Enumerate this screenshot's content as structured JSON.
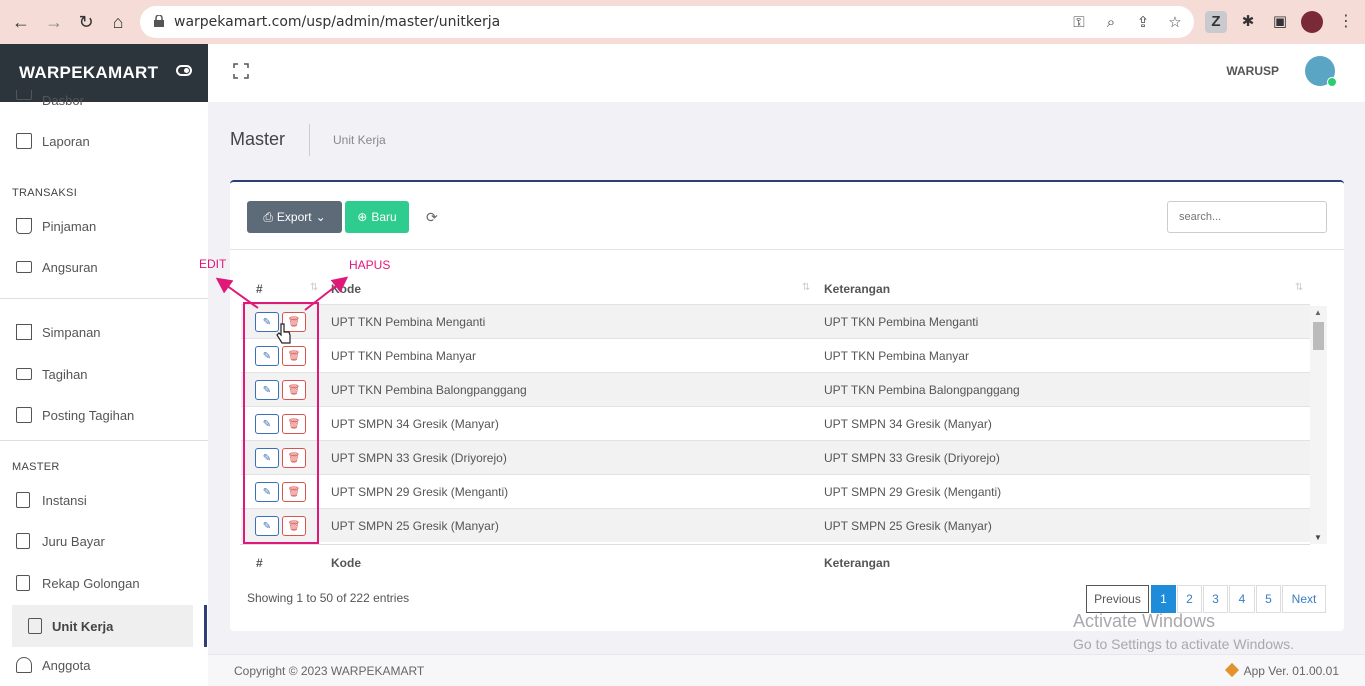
{
  "browser": {
    "url": "warpekamart.com/usp/admin/master/unitkerja"
  },
  "sidebar": {
    "brand": "WARPEKAMART",
    "top_items": [
      {
        "label": "Dasbor"
      },
      {
        "label": "Laporan"
      }
    ],
    "section_transaksi": "TRANSAKSI",
    "transaksi_items": [
      {
        "label": "Pinjaman"
      },
      {
        "label": "Angsuran"
      }
    ],
    "mid_items": [
      {
        "label": "Simpanan"
      },
      {
        "label": "Tagihan"
      },
      {
        "label": "Posting Tagihan"
      }
    ],
    "section_master": "MASTER",
    "master_items": [
      {
        "label": "Instansi"
      },
      {
        "label": "Juru Bayar"
      },
      {
        "label": "Rekap Golongan"
      },
      {
        "label": "Unit Kerja"
      },
      {
        "label": "Anggota"
      }
    ]
  },
  "header": {
    "user_name": "WARUSP"
  },
  "page": {
    "title": "Master",
    "breadcrumb": "Unit Kerja"
  },
  "toolbar": {
    "export_label": "Export",
    "new_label": "Baru",
    "search_placeholder": "search..."
  },
  "table": {
    "columns": [
      "#",
      "Kode",
      "Keterangan"
    ],
    "rows": [
      {
        "kode": "UPT TKN Pembina Menganti",
        "keterangan": "UPT TKN Pembina Menganti"
      },
      {
        "kode": "UPT TKN Pembina Manyar",
        "keterangan": "UPT TKN Pembina Manyar"
      },
      {
        "kode": "UPT TKN Pembina Balongpanggang",
        "keterangan": "UPT TKN Pembina Balongpanggang"
      },
      {
        "kode": "UPT SMPN 34 Gresik (Manyar)",
        "keterangan": "UPT SMPN 34 Gresik (Manyar)"
      },
      {
        "kode": "UPT SMPN 33 Gresik (Driyorejo)",
        "keterangan": "UPT SMPN 33 Gresik (Driyorejo)"
      },
      {
        "kode": "UPT SMPN 29 Gresik (Menganti)",
        "keterangan": "UPT SMPN 29 Gresik (Menganti)"
      },
      {
        "kode": "UPT SMPN 25 Gresik (Manyar)",
        "keterangan": "UPT SMPN 25 Gresik (Manyar)"
      }
    ],
    "info": "Showing 1 to 50 of 222 entries"
  },
  "pagination": {
    "previous": "Previous",
    "pages": [
      "1",
      "2",
      "3",
      "4",
      "5"
    ],
    "active_page": "1",
    "next": "Next"
  },
  "annotations": {
    "edit": "EDIT",
    "hapus": "HAPUS",
    "color": "#e0187a"
  },
  "watermark": {
    "line1": "Activate Windows",
    "line2": "Go to Settings to activate Windows."
  },
  "footer": {
    "copyright": "Copyright © 2023 WARPEKAMART",
    "version": "App Ver. 01.00.01"
  }
}
